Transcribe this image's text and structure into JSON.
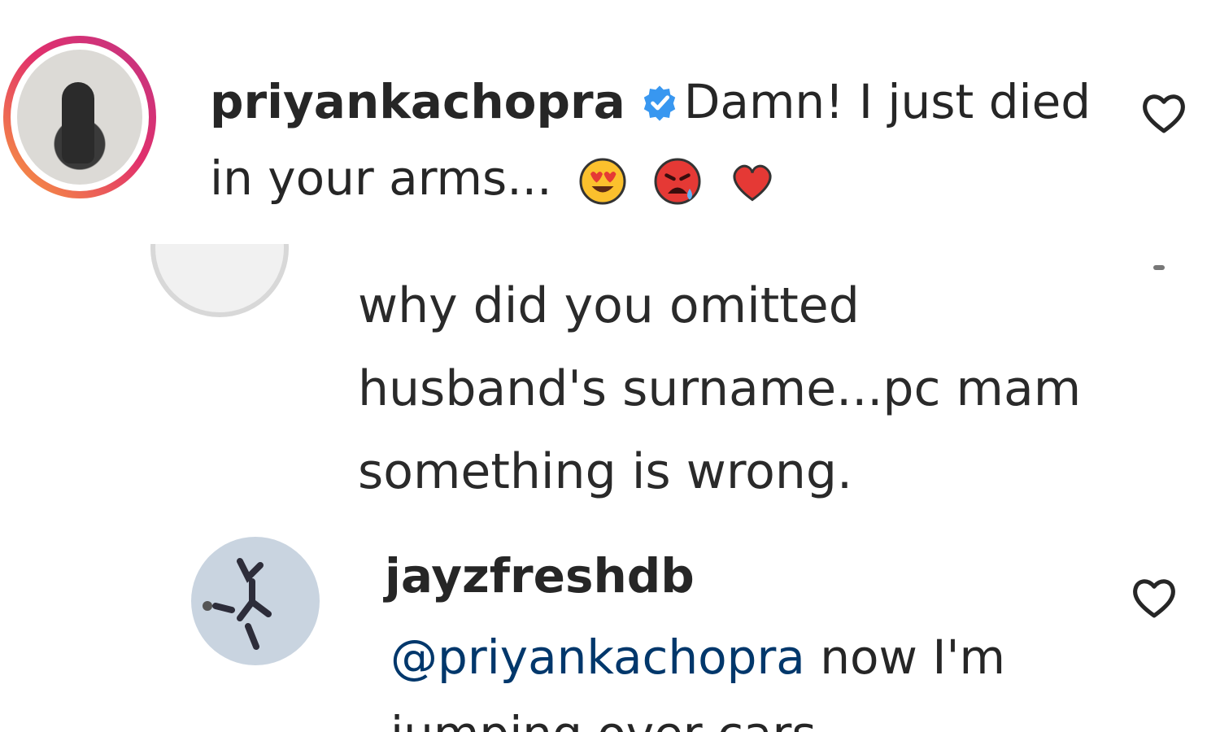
{
  "comments": [
    {
      "username": "priyankachopra",
      "verified": true,
      "text": "Damn! I just died in your arms...",
      "emojis": [
        "heart-eyes-emoji",
        "crying-face-emoji",
        "red-heart-emoji"
      ]
    },
    {
      "text": "why did you omitted husband's surname...pc mam something is wrong."
    },
    {
      "username": "jayzfreshdb",
      "mention": "@priyankachopra",
      "text": "now I'm",
      "text_continued": "jumping over cars"
    }
  ],
  "colors": {
    "verified_badge": "#3897f0",
    "mention": "#00376b",
    "ring_start": "#f9a03c",
    "ring_end": "#c13584"
  }
}
